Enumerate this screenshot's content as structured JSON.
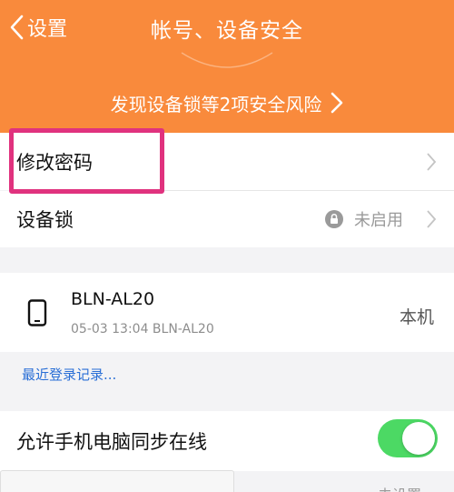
{
  "header": {
    "back_label": "设置",
    "title": "帐号、设备安全",
    "risk_text": "发现设备锁等2项安全风险",
    "background": "#f98a3c"
  },
  "menu": {
    "change_password": "修改密码",
    "device_lock": "设备锁",
    "device_lock_status": "未启用"
  },
  "device": {
    "name": "BLN-AL20",
    "login_info": "05-03 13:04 BLN-AL20",
    "this_device": "本机",
    "icon": "phone-icon"
  },
  "recent_login": "最近登录记录...",
  "sync": {
    "label": "允许手机电脑同步在线",
    "enabled": true,
    "toggle_color": "#4cd964"
  },
  "partial_text": "未设置",
  "highlight_color": "#e0327e",
  "link_color": "#2a6fd6"
}
